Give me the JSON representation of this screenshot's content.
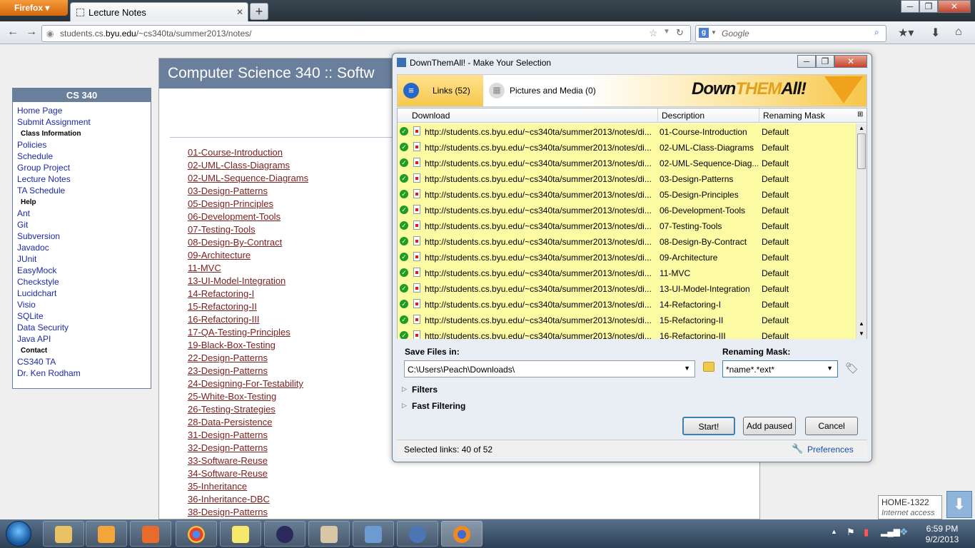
{
  "browser": {
    "firefox_button": "Firefox",
    "tab_title": "Lecture Notes",
    "url_prefix": "students.cs.",
    "url_host": "byu.edu",
    "url_path": "/~cs340ta/summer2013/notes/",
    "search_placeholder": "Google"
  },
  "page": {
    "banner": "Computer Science 340 :: Softw",
    "sidebar_title": "CS 340",
    "sidebar": [
      {
        "type": "link",
        "text": "Home Page"
      },
      {
        "type": "link",
        "text": "Submit Assignment"
      },
      {
        "type": "head",
        "text": "Class Information"
      },
      {
        "type": "link",
        "text": "Policies"
      },
      {
        "type": "link",
        "text": "Schedule"
      },
      {
        "type": "link",
        "text": "Group Project"
      },
      {
        "type": "link",
        "text": "Lecture Notes"
      },
      {
        "type": "link",
        "text": "TA Schedule"
      },
      {
        "type": "head",
        "text": "Help"
      },
      {
        "type": "link",
        "text": "Ant"
      },
      {
        "type": "link",
        "text": "Git"
      },
      {
        "type": "link",
        "text": "Subversion"
      },
      {
        "type": "link",
        "text": "Javadoc"
      },
      {
        "type": "link",
        "text": "JUnit"
      },
      {
        "type": "link",
        "text": "EasyMock"
      },
      {
        "type": "link",
        "text": "Checkstyle"
      },
      {
        "type": "link",
        "text": "Lucidchart"
      },
      {
        "type": "link",
        "text": "Visio"
      },
      {
        "type": "link",
        "text": "SQLite"
      },
      {
        "type": "link",
        "text": "Data Security"
      },
      {
        "type": "link",
        "text": "Java API"
      },
      {
        "type": "head",
        "text": "Contact"
      },
      {
        "type": "link",
        "text": "CS340 TA"
      },
      {
        "type": "link",
        "text": "Dr. Ken Rodham"
      }
    ],
    "notes": [
      "01-Course-Introduction",
      "02-UML-Class-Diagrams",
      "02-UML-Sequence-Diagrams",
      "03-Design-Patterns",
      "05-Design-Principles",
      "06-Development-Tools",
      "07-Testing-Tools",
      "08-Design-By-Contract",
      "09-Architecture",
      "11-MVC",
      "13-UI-Model-Integration",
      "14-Refactoring-I",
      "15-Refactoring-II",
      "16-Refactoring-III",
      "17-QA-Testing-Principles",
      "19-Black-Box-Testing",
      "22-Design-Patterns",
      "23-Design-Patterns",
      "24-Designing-For-Testability",
      "25-White-Box-Testing",
      "26-Testing-Strategies",
      "28-Data-Persistence",
      "31-Design-Patterns",
      "32-Design-Patterns",
      "33-Software-Reuse",
      "34-Software-Reuse",
      "35-Inheritance",
      "36-Inheritance-DBC",
      "38-Design-Patterns"
    ]
  },
  "dialog": {
    "title": "DownThemAll! - Make Your Selection",
    "tab_links": "Links (52)",
    "tab_pics": "Pictures and Media (0)",
    "logo_a": "Down",
    "logo_b": "THEM",
    "logo_c": "All!",
    "col_download": "Download",
    "col_description": "Description",
    "col_mask": "Renaming Mask",
    "rows": [
      {
        "url": "http://students.cs.byu.edu/~cs340ta/summer2013/notes/di...",
        "desc": "01-Course-Introduction",
        "mask": "Default"
      },
      {
        "url": "http://students.cs.byu.edu/~cs340ta/summer2013/notes/di...",
        "desc": "02-UML-Class-Diagrams",
        "mask": "Default"
      },
      {
        "url": "http://students.cs.byu.edu/~cs340ta/summer2013/notes/di...",
        "desc": "02-UML-Sequence-Diag...",
        "mask": "Default"
      },
      {
        "url": "http://students.cs.byu.edu/~cs340ta/summer2013/notes/di...",
        "desc": "03-Design-Patterns",
        "mask": "Default"
      },
      {
        "url": "http://students.cs.byu.edu/~cs340ta/summer2013/notes/di...",
        "desc": "05-Design-Principles",
        "mask": "Default"
      },
      {
        "url": "http://students.cs.byu.edu/~cs340ta/summer2013/notes/di...",
        "desc": "06-Development-Tools",
        "mask": "Default"
      },
      {
        "url": "http://students.cs.byu.edu/~cs340ta/summer2013/notes/di...",
        "desc": "07-Testing-Tools",
        "mask": "Default"
      },
      {
        "url": "http://students.cs.byu.edu/~cs340ta/summer2013/notes/di...",
        "desc": "08-Design-By-Contract",
        "mask": "Default"
      },
      {
        "url": "http://students.cs.byu.edu/~cs340ta/summer2013/notes/di...",
        "desc": "09-Architecture",
        "mask": "Default"
      },
      {
        "url": "http://students.cs.byu.edu/~cs340ta/summer2013/notes/di...",
        "desc": "11-MVC",
        "mask": "Default"
      },
      {
        "url": "http://students.cs.byu.edu/~cs340ta/summer2013/notes/di...",
        "desc": "13-UI-Model-Integration",
        "mask": "Default"
      },
      {
        "url": "http://students.cs.byu.edu/~cs340ta/summer2013/notes/di...",
        "desc": "14-Refactoring-I",
        "mask": "Default"
      },
      {
        "url": "http://students.cs.byu.edu/~cs340ta/summer2013/notes/di...",
        "desc": "15-Refactoring-II",
        "mask": "Default"
      },
      {
        "url": "http://students.cs.byu.edu/~cs340ta/summer2013/notes/di...",
        "desc": "16-Refactoring-III",
        "mask": "Default"
      }
    ],
    "save_label": "Save Files in:",
    "save_path": "C:\\Users\\Peach\\Downloads\\",
    "mask_label": "Renaming Mask:",
    "mask_value": "*name*.*ext*",
    "filters": "Filters",
    "fast_filtering": "Fast Filtering",
    "btn_start": "Start!",
    "btn_add_paused": "Add paused",
    "btn_cancel": "Cancel",
    "status": "Selected links: 40 of 52",
    "preferences": "Preferences"
  },
  "network": {
    "name": "HOME-1322",
    "status": "Internet access"
  },
  "clock": {
    "time": "6:59 PM",
    "date": "9/2/2013"
  }
}
